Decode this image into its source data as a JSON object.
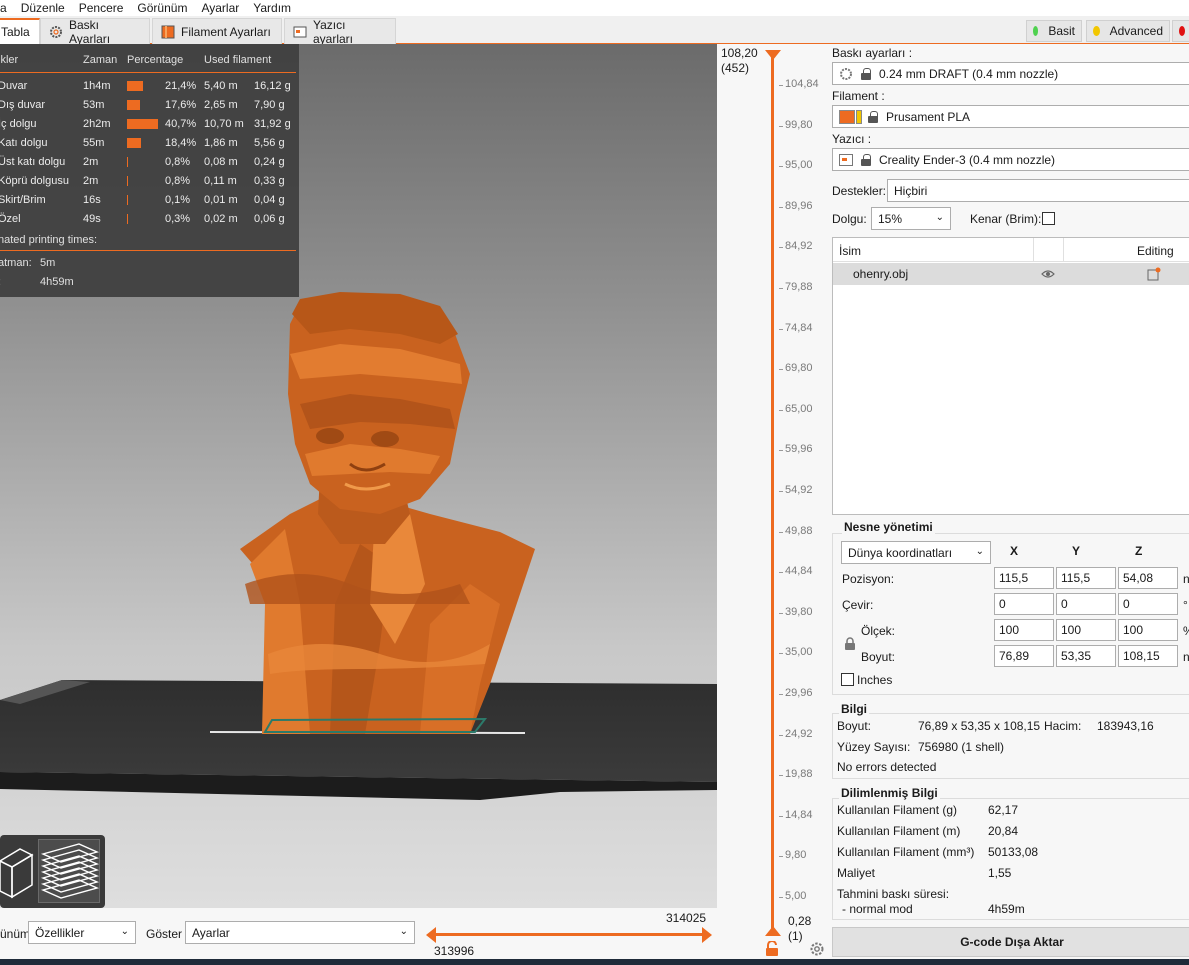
{
  "menu": [
    "a",
    "Düzenle",
    "Pencere",
    "Görünüm",
    "Ayarlar",
    "Yardım"
  ],
  "tabs": [
    {
      "label": "Tabla",
      "icon": "bed-icon",
      "active": true
    },
    {
      "label": "Baskı Ayarları",
      "icon": "gear-icon"
    },
    {
      "label": "Filament Ayarları",
      "icon": "filament-spool-icon"
    },
    {
      "label": "Yazıcı ayarları",
      "icon": "printer-icon"
    }
  ],
  "modes": [
    {
      "label": "Basit",
      "color": "#4fd14f"
    },
    {
      "label": "Advanced",
      "color": "#f2c700"
    },
    {
      "label": "",
      "color": "#e01010"
    }
  ],
  "legend": {
    "headers": {
      "type": "ikler",
      "time": "Zaman",
      "percentage": "Percentage",
      "used": "Used filament"
    },
    "rows": [
      {
        "name": "Duvar",
        "time": "1h4m",
        "pct": "21,4%",
        "len": "5,40 m",
        "weight": "16,12 g",
        "fraction": 0.214
      },
      {
        "name": "Dış duvar",
        "time": "53m",
        "pct": "17,6%",
        "len": "2,65 m",
        "weight": "7,90 g",
        "fraction": 0.176
      },
      {
        "name": "İç dolgu",
        "time": "2h2m",
        "pct": "40,7%",
        "len": "10,70 m",
        "weight": "31,92 g",
        "fraction": 0.407
      },
      {
        "name": "Katı dolgu",
        "time": "55m",
        "pct": "18,4%",
        "len": "1,86 m",
        "weight": "5,56 g",
        "fraction": 0.184
      },
      {
        "name": "Üst katı dolgu",
        "time": "2m",
        "pct": "0,8%",
        "len": "0,08 m",
        "weight": "0,24 g",
        "fraction": 0.008
      },
      {
        "name": "Köprü dolgusu",
        "time": "2m",
        "pct": "0,8%",
        "len": "0,11 m",
        "weight": "0,33 g",
        "fraction": 0.008
      },
      {
        "name": "Skirt/Brim",
        "time": "16s",
        "pct": "0,1%",
        "len": "0,01 m",
        "weight": "0,04 g",
        "fraction": 0.001
      },
      {
        "name": "Özel",
        "time": "49s",
        "pct": "0,3%",
        "len": "0,02 m",
        "weight": "0,06 g",
        "fraction": 0.003
      }
    ],
    "estimated_title": "nated printing times:",
    "first_layer_label": "atman:",
    "first_layer_value": "5m",
    "total_label": ":",
    "total_value": "4h59m"
  },
  "vslider": {
    "top_value": "108,20",
    "top_layer": "(452)",
    "bottom_value": "0,28",
    "bottom_layer": "(1)",
    "ticks": [
      "104,84",
      "99,80",
      "95,00",
      "89,96",
      "84,92",
      "79,88",
      "74,84",
      "69,80",
      "65,00",
      "59,96",
      "54,92",
      "49,88",
      "44,84",
      "39,80",
      "35,00",
      "29,96",
      "24,92",
      "19,88",
      "14,84",
      "9,80",
      "5,00"
    ]
  },
  "hslider": {
    "top_value": "314025",
    "bottom_value": "313996"
  },
  "bottom": {
    "view_label": "ünüm",
    "view_value": "Özellikler",
    "show_label": "Göster",
    "show_value": "Ayarlar"
  },
  "right": {
    "print_label": "Baskı ayarları :",
    "print_value": "0.24 mm DRAFT (0.4 mm nozzle)",
    "filament_label": "Filament :",
    "filament_value": "Prusament PLA",
    "printer_label": "Yazıcı :",
    "printer_value": "Creality Ender-3 (0.4 mm nozzle)",
    "supports_label": "Destekler:",
    "supports_value": "Hiçbiri",
    "infill_label": "Dolgu:",
    "infill_value": "15%",
    "brim_label": "Kenar (Brim):",
    "list_headers": {
      "name": "İsim",
      "editing": "Editing"
    },
    "objects": [
      {
        "name": "ohenry.obj"
      }
    ]
  },
  "object_manipulation": {
    "title": "Nesne yönetimi",
    "coord_value": "Dünya koordinatları",
    "axes": [
      "X",
      "Y",
      "Z"
    ],
    "rows": [
      {
        "label": "Pozisyon:",
        "values": [
          "115,5",
          "115,5",
          "54,08"
        ],
        "unit": "n"
      },
      {
        "label": "Çevir:",
        "values": [
          "0",
          "0",
          "0"
        ],
        "unit": "°"
      },
      {
        "label": "Ölçek:",
        "values": [
          "100",
          "100",
          "100"
        ],
        "unit": "%"
      },
      {
        "label": "Boyut:",
        "values": [
          "76,89",
          "53,35",
          "108,15"
        ],
        "unit": "n"
      }
    ],
    "inches_label": "Inches"
  },
  "info": {
    "title": "Bilgi",
    "size_label": "Boyut:",
    "size_value": "76,89 x 53,35 x 108,15",
    "volume_label": "Hacim:",
    "volume_value": "183943,16",
    "facets_label": "Yüzey Sayısı:",
    "facets_value": "756980 (1 shell)",
    "errors": "No errors detected"
  },
  "sliced": {
    "title": "Dilimlenmiş Bilgi",
    "rows": [
      {
        "label": "Kullanılan Filament (g)",
        "value": "62,17"
      },
      {
        "label": "Kullanılan Filament (m)",
        "value": "20,84"
      },
      {
        "label": "Kullanılan Filament (mm³)",
        "value": "50133,08"
      },
      {
        "label": "Maliyet",
        "value": "1,55"
      }
    ],
    "time_label": "Tahmini baskı süresi:",
    "mode_label": "- normal mod",
    "mode_value": "4h59m"
  },
  "export_label": "G-code Dışa Aktar",
  "colors": {
    "accent": "#ed6b21",
    "model": "#c9621f",
    "panel_dark": "#404040"
  }
}
